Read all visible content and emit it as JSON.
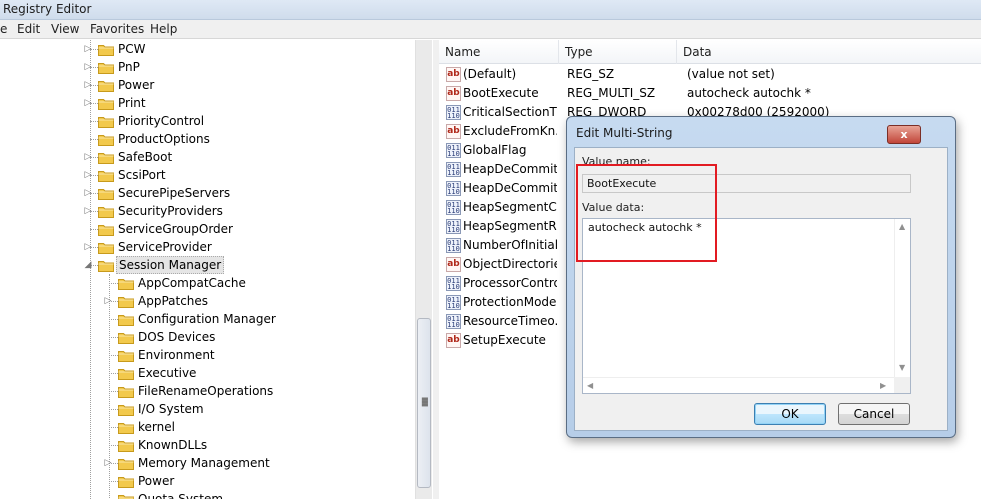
{
  "window": {
    "title": "Registry Editor"
  },
  "menu": [
    {
      "label": "e"
    },
    {
      "label": "Edit"
    },
    {
      "label": "View"
    },
    {
      "label": "Favorites"
    },
    {
      "label": "Help"
    }
  ],
  "tree": {
    "items": [
      {
        "label": "PCW"
      },
      {
        "label": "PnP"
      },
      {
        "label": "Power"
      },
      {
        "label": "Print"
      },
      {
        "label": "PriorityControl"
      },
      {
        "label": "ProductOptions"
      },
      {
        "label": "SafeBoot"
      },
      {
        "label": "ScsiPort"
      },
      {
        "label": "SecurePipeServers"
      },
      {
        "label": "SecurityProviders"
      },
      {
        "label": "ServiceGroupOrder"
      },
      {
        "label": "ServiceProvider"
      },
      {
        "label": "Session Manager"
      },
      {
        "label": "AppCompatCache"
      },
      {
        "label": "AppPatches"
      },
      {
        "label": "Configuration Manager"
      },
      {
        "label": "DOS Devices"
      },
      {
        "label": "Environment"
      },
      {
        "label": "Executive"
      },
      {
        "label": "FileRenameOperations"
      },
      {
        "label": "I/O System"
      },
      {
        "label": "kernel"
      },
      {
        "label": "KnownDLLs"
      },
      {
        "label": "Memory Management"
      },
      {
        "label": "Power"
      },
      {
        "label": "Quota System"
      }
    ]
  },
  "list": {
    "columns": {
      "name": "Name",
      "type": "Type",
      "data": "Data"
    },
    "rows": [
      {
        "name": "(Default)",
        "type": "REG_SZ",
        "data": "(value not set)",
        "icon": "string-value-icon"
      },
      {
        "name": "BootExecute",
        "type": "REG_MULTI_SZ",
        "data": "autocheck autochk *",
        "icon": "string-value-icon"
      },
      {
        "name": "CriticalSectionTi...",
        "type": "REG_DWORD",
        "data": "0x00278d00 (2592000)",
        "icon": "binary-value-icon"
      },
      {
        "name": "ExcludeFromKn...",
        "type": "",
        "data": "",
        "icon": "string-value-icon"
      },
      {
        "name": "GlobalFlag",
        "type": "",
        "data": "",
        "icon": "binary-value-icon"
      },
      {
        "name": "HeapDeCommit...",
        "type": "",
        "data": "",
        "icon": "binary-value-icon"
      },
      {
        "name": "HeapDeCommit...",
        "type": "",
        "data": "",
        "icon": "binary-value-icon"
      },
      {
        "name": "HeapSegmentC...",
        "type": "",
        "data": "",
        "icon": "binary-value-icon"
      },
      {
        "name": "HeapSegmentR...",
        "type": "",
        "data": "",
        "icon": "binary-value-icon"
      },
      {
        "name": "NumberOfInitial...",
        "type": "",
        "data": "",
        "icon": "binary-value-icon"
      },
      {
        "name": "ObjectDirectories",
        "type": "",
        "data": "",
        "icon": "string-value-icon"
      },
      {
        "name": "ProcessorControl",
        "type": "",
        "data": "",
        "icon": "binary-value-icon"
      },
      {
        "name": "ProtectionMode",
        "type": "",
        "data": "",
        "icon": "binary-value-icon"
      },
      {
        "name": "ResourceTimeo...",
        "type": "",
        "data": "",
        "icon": "binary-value-icon"
      },
      {
        "name": "SetupExecute",
        "type": "",
        "data": "",
        "icon": "string-value-icon"
      }
    ]
  },
  "dialog": {
    "title": "Edit Multi-String",
    "close_label": "x",
    "value_name_label": "Value name:",
    "value_name": "BootExecute",
    "value_data_label": "Value data:",
    "value_data": "autocheck autochk *",
    "ok_label": "OK",
    "cancel_label": "Cancel"
  },
  "colors": {
    "highlight": "#e21b22",
    "folder": "#f2c94c"
  }
}
